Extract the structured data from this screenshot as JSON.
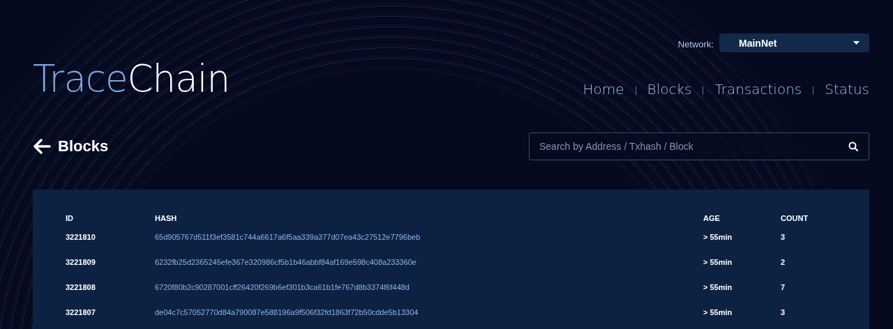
{
  "network": {
    "label": "Network:",
    "value": "MainNet"
  },
  "logo": {
    "parts": [
      {
        "text": "Trace",
        "color": "#7fa8dc"
      },
      {
        "text": "Chain",
        "color": "#ffffff"
      }
    ]
  },
  "nav": [
    {
      "label": "Home"
    },
    {
      "label": "Blocks"
    },
    {
      "label": "Transactions"
    },
    {
      "label": "Status"
    }
  ],
  "page_title": "Blocks",
  "search": {
    "placeholder": "Search by Address / Txhash / Block"
  },
  "table": {
    "columns": [
      "ID",
      "HASH",
      "AGE",
      "COUNT"
    ],
    "rows": [
      [
        "3221810",
        "65d905767d511f3ef3581c744a6617a6f5aa339a377d07ea43c27512e7796beb",
        "> 55min",
        "3"
      ],
      [
        "3221809",
        "6232fb25d2365245efe367e320986cf5b1b46abbf84af169e598c408a233360e",
        "> 55min",
        "2"
      ],
      [
        "3221808",
        "6720f80b2c90287001cff26420f269b6ef301b3ca61b1fe767d8b3374f6f448d",
        "> 55min",
        "7"
      ],
      [
        "3221807",
        "de04c7c57052770d84a790087e588196a9f506f32fd1863f72b50cdde5b13304",
        "> 55min",
        "3"
      ]
    ]
  }
}
